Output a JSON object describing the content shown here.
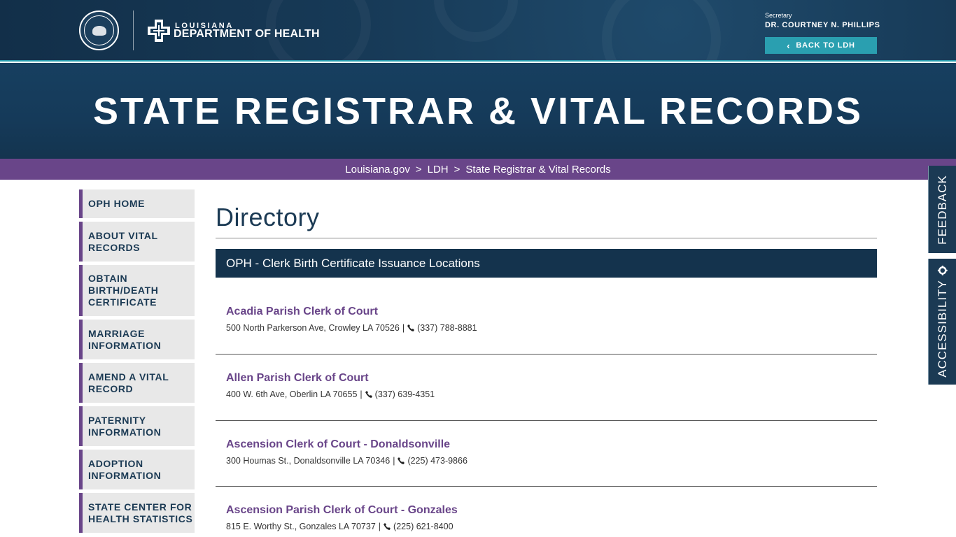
{
  "header": {
    "logo_small": "LOUISIANA",
    "logo_big": "DEPARTMENT OF HEALTH",
    "secretary_label": "Secretary",
    "secretary_name": "DR. COURTNEY N. PHILLIPS",
    "back_button": "BACK TO LDH"
  },
  "banner": {
    "title": "STATE REGISTRAR & VITAL RECORDS"
  },
  "breadcrumb": {
    "items": [
      "Louisiana.gov",
      "LDH",
      "State Registrar & Vital Records"
    ],
    "separator": ">"
  },
  "sidebar": {
    "items": [
      {
        "label": "OPH HOME"
      },
      {
        "label": "ABOUT VITAL RECORDS"
      },
      {
        "label": "OBTAIN BIRTH/DEATH CERTIFICATE"
      },
      {
        "label": "MARRIAGE INFORMATION"
      },
      {
        "label": "AMEND A VITAL RECORD"
      },
      {
        "label": "PATERNITY INFORMATION"
      },
      {
        "label": "ADOPTION INFORMATION"
      },
      {
        "label": "STATE CENTER FOR HEALTH STATISTICS"
      }
    ]
  },
  "main": {
    "title": "Directory",
    "section_title": "OPH - Clerk Birth Certificate Issuance Locations",
    "entries": [
      {
        "name": "Acadia Parish Clerk of Court",
        "address": "500 North Parkerson Ave, Crowley LA 70526",
        "phone": "(337) 788-8881"
      },
      {
        "name": "Allen Parish Clerk of Court",
        "address": "400 W. 6th Ave, Oberlin LA 70655",
        "phone": "(337) 639-4351"
      },
      {
        "name": "Ascension Clerk of Court - Donaldsonville",
        "address": "300 Houmas St., Donaldsonville LA 70346",
        "phone": "(225) 473-9866"
      },
      {
        "name": "Ascension Parish Clerk of Court - Gonzales",
        "address": "815 E. Worthy St., Gonzales LA 70737",
        "phone": "(225) 621-8400"
      }
    ],
    "pipe": "|"
  },
  "right_tabs": {
    "feedback": "FEEDBACK",
    "accessibility": "ACCESSIBILITY"
  },
  "colors": {
    "navy": "#14334d",
    "purple": "#694589",
    "teal": "#2a9fb0"
  }
}
